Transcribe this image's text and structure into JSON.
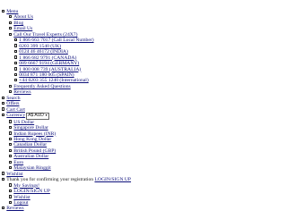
{
  "nav": {
    "menu": {
      "label": "Menu",
      "items": [
        {
          "label": "About Us"
        },
        {
          "label": "Blog"
        },
        {
          "label": "Email Us"
        },
        {
          "label": "Call Our Travel Experts (24X7)",
          "phones": [
            "1 866 663 7017 (Call Local Number)",
            "0203 399 1540 (UK)",
            "0124 46 46172 (INDIA)",
            "1 866 682 9791 (CANADA)",
            "089 6667 9194 (GERMANY)",
            "1 800 008 739 (AUSTRALIA)",
            "0034 871 180 005 (SPAIN)",
            "+44 0203 355 1240 (International)"
          ]
        },
        {
          "label": "Frequently Asked Questions"
        },
        {
          "label": "Reviews"
        }
      ]
    },
    "search": "Search",
    "offers": "Offers",
    "cart": "Cart Cart",
    "currency": {
      "label": "Currency",
      "selected": "A$ AUD",
      "options": [
        "US Dollar",
        "Singapore Dollar",
        "Indian Rupees (INR)",
        "Hong Kong Dollar",
        "Canadian Dollar",
        "British Pound (GBP)",
        "Australian Dollar",
        "Euro",
        "Malaysian Ringgit"
      ]
    },
    "wishlist": "Wishlist",
    "thankyou": {
      "text": "Thank you for confirming your registration",
      "link": "LOGIN/SIGN UP",
      "items": [
        "My Savings!",
        "LOGIN/SIGN UP",
        "Wishlist",
        "Logout"
      ]
    },
    "reviews": "Reviews"
  }
}
